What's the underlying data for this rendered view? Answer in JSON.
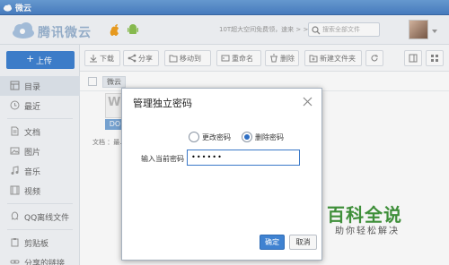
{
  "window": {
    "title": "微云"
  },
  "header": {
    "logo_text": "腾讯微云",
    "notice": "10T超大空间免费领，速来 > >",
    "search_placeholder": "搜索全部文件"
  },
  "sidebar": {
    "upload_label": "上传",
    "items": [
      {
        "label": "目录",
        "icon": "grid-icon"
      },
      {
        "label": "最近",
        "icon": "clock-icon"
      },
      {
        "label": "文档",
        "icon": "document-icon"
      },
      {
        "label": "图片",
        "icon": "image-icon"
      },
      {
        "label": "音乐",
        "icon": "music-icon"
      },
      {
        "label": "视频",
        "icon": "video-icon"
      },
      {
        "label": "QQ离线文件",
        "icon": "qq-icon"
      },
      {
        "label": "剪贴板",
        "icon": "clipboard-icon"
      },
      {
        "label": "分享的链接",
        "icon": "link-icon"
      }
    ]
  },
  "toolbar": {
    "download": "下载",
    "share": "分享",
    "move": "移动到",
    "rename": "重命名",
    "delete": "删除",
    "new_folder": "新建文件夹"
  },
  "breadcrumb": {
    "current": "微云"
  },
  "background_content": {
    "thumb_letter": "W",
    "file_tag": "DO",
    "file_text": "文档 ：最..."
  },
  "dialog": {
    "title": "管理独立密码",
    "option_change": "更改密码",
    "option_delete": "删除密码",
    "selected_option": "删除密码",
    "password_label": "输入当前密码",
    "password_value": "••••••",
    "ok_label": "确定",
    "cancel_label": "取消"
  },
  "watermark": {
    "title": "百科全说",
    "subtitle": "助你轻松解决"
  }
}
